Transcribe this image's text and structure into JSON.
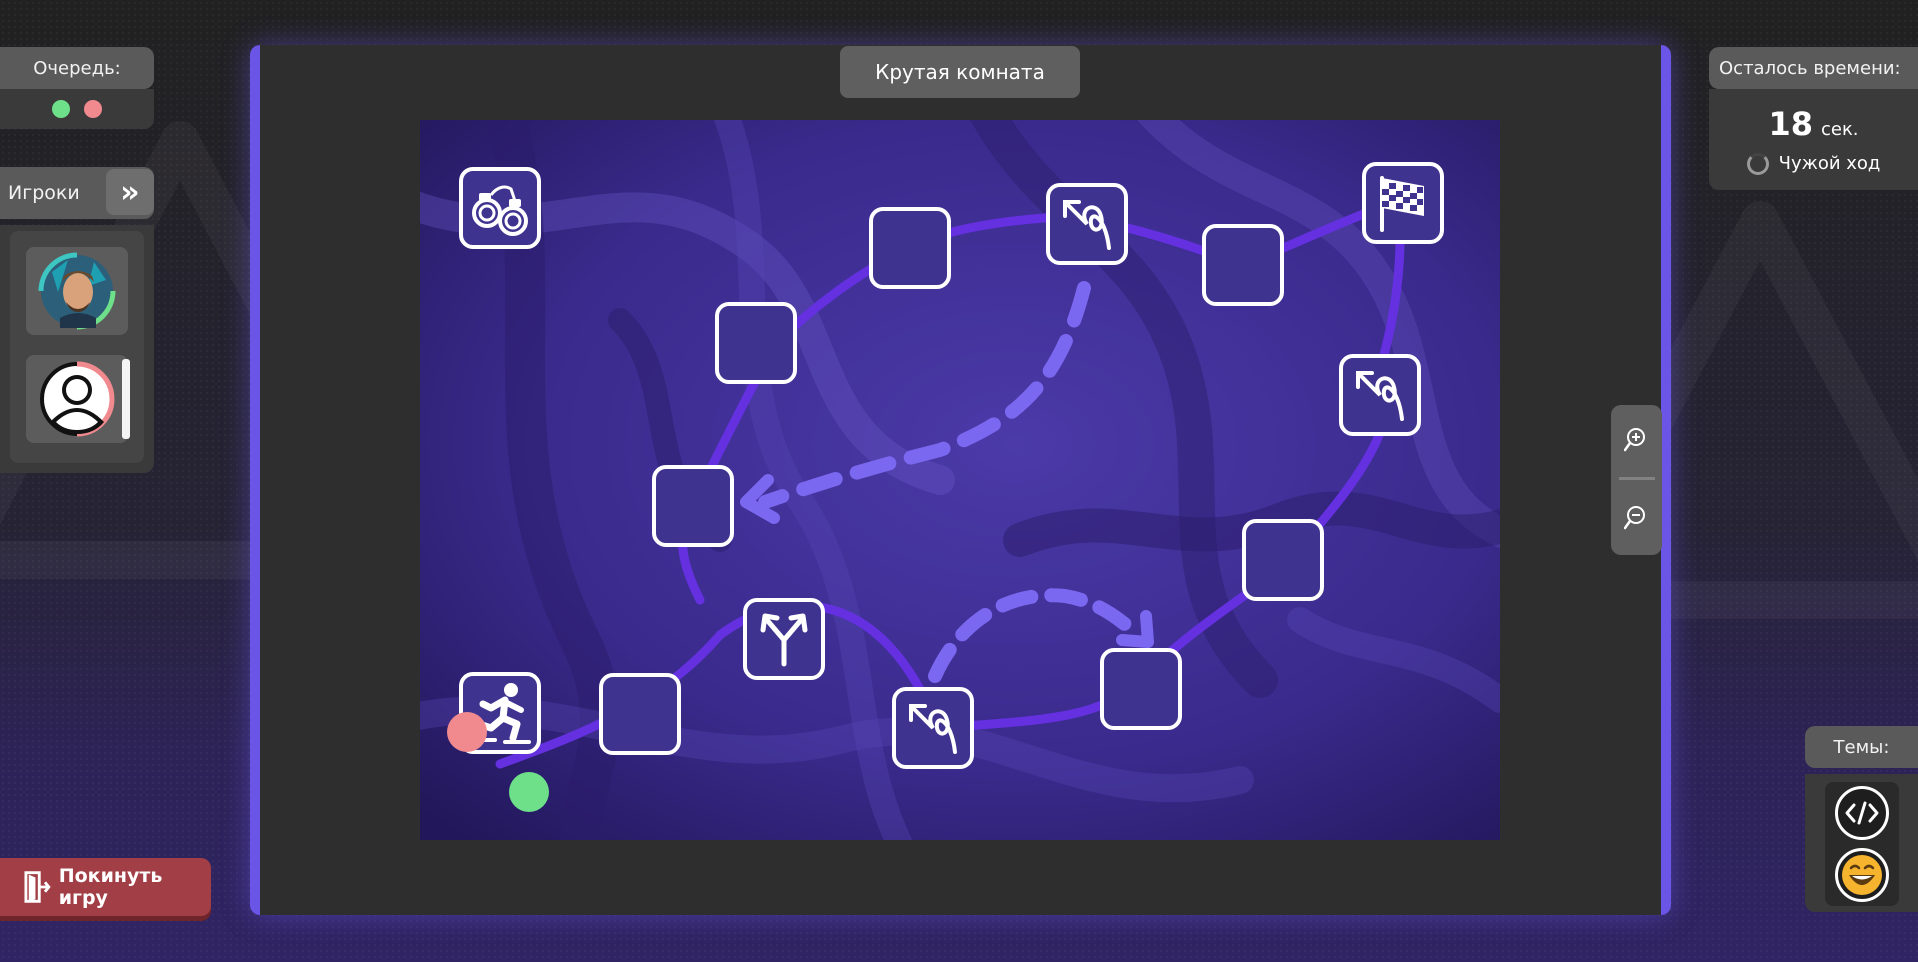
{
  "queue": {
    "title": "Очередь:",
    "dots": [
      {
        "name": "queue-dot-green",
        "color": "#6ee08a"
      },
      {
        "name": "queue-dot-red",
        "color": "#f08a8e"
      }
    ]
  },
  "players": {
    "title": "Игроки",
    "expand_icon": "double-chevron-right-icon",
    "list": [
      {
        "avatar": "avatar-photo",
        "ring_color": "#6ee08a"
      },
      {
        "avatar": "avatar-default",
        "ring_color": "#f08a8e"
      }
    ]
  },
  "leave_button": {
    "label": "Покинуть игру",
    "icon": "exit-door-icon"
  },
  "room": {
    "title": "Крутая комната"
  },
  "board": {
    "cells": [
      {
        "id": "start",
        "icon": "skater-icon"
      },
      {
        "id": "c1",
        "icon": ""
      },
      {
        "id": "c2",
        "icon": "fork-arrows-icon"
      },
      {
        "id": "c3",
        "icon": "loop-back-icon"
      },
      {
        "id": "c4",
        "icon": ""
      },
      {
        "id": "c5",
        "icon": ""
      },
      {
        "id": "c6",
        "icon": "loop-back-icon"
      },
      {
        "id": "c7",
        "icon": "flag-icon"
      },
      {
        "id": "c8",
        "icon": "loop-back-icon"
      },
      {
        "id": "c9",
        "icon": ""
      },
      {
        "id": "c10",
        "icon": ""
      },
      {
        "id": "c11",
        "icon": ""
      },
      {
        "id": "c12",
        "icon": ""
      },
      {
        "id": "jail",
        "icon": "handcuffs-icon"
      }
    ],
    "tokens": [
      {
        "name": "token-red",
        "color": "#f08a8e"
      },
      {
        "name": "token-green",
        "color": "#6ee08a"
      }
    ]
  },
  "timer": {
    "title": "Осталось времени:",
    "value": "18",
    "unit": "сек.",
    "turn_status": "Чужой ход"
  },
  "zoom": {
    "in_icon": "zoom-in-icon",
    "out_icon": "zoom-out-icon"
  },
  "themes": {
    "title": "Темы:",
    "items": [
      {
        "icon": "code-brackets-icon"
      },
      {
        "icon": "laughing-face-icon"
      }
    ]
  },
  "colors": {
    "accent": "#6a55e6",
    "leave": "#a23f46",
    "cell_fill": "#3f3390"
  }
}
